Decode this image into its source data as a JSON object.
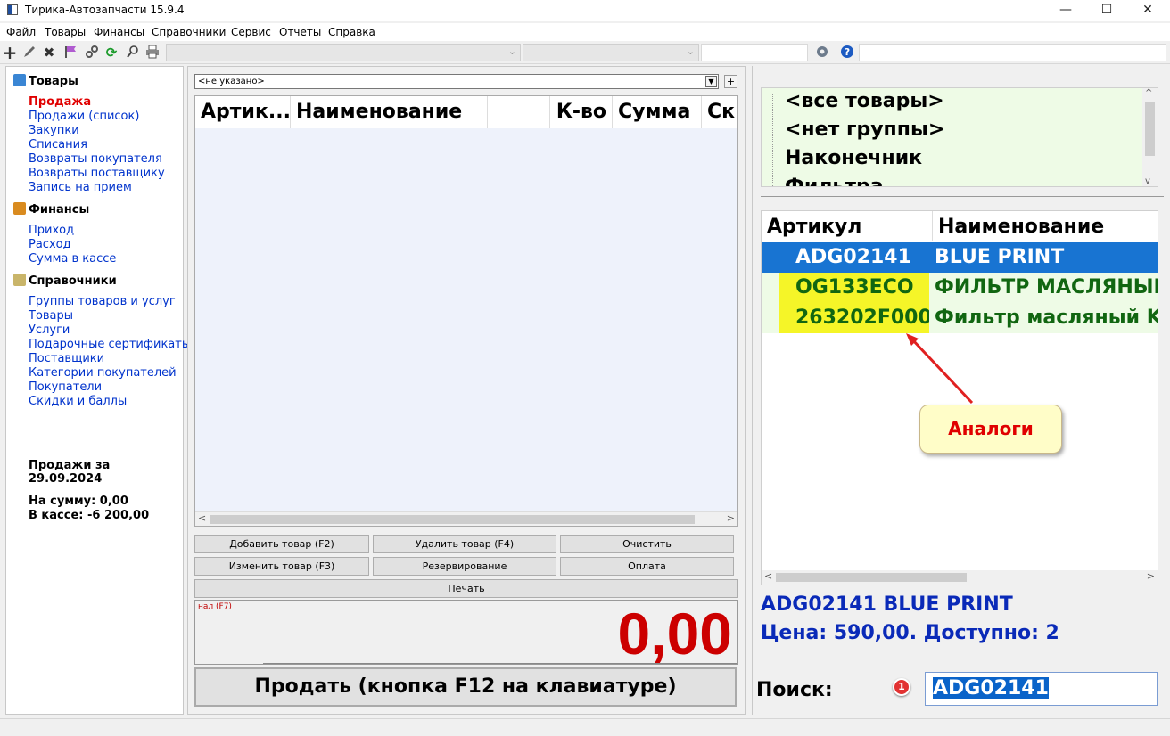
{
  "window": {
    "title": "Тирика-Автозапчасти 15.9.4",
    "min": "—",
    "max": "☐",
    "close": "✕"
  },
  "menu": [
    "Файл",
    "Товары",
    "Финансы",
    "Справочники",
    "Сервис",
    "Отчеты",
    "Справка"
  ],
  "toolbar": {
    "icons": [
      "add-icon",
      "edit-icon",
      "delete-icon",
      "flag-icon",
      "link-icon",
      "refresh-icon",
      "search-icon",
      "print-icon",
      "settings-icon",
      "help-icon"
    ],
    "combo_arrow": "⌄"
  },
  "nav": {
    "sections": [
      {
        "title": "Товары",
        "icon": "box-icon",
        "color": "#3a86d4",
        "items": [
          "Продажа",
          "Продажи (список)",
          "Закупки",
          "Списания",
          "Возвраты покупателя",
          "Возвраты поставщику",
          "Запись на прием"
        ]
      },
      {
        "title": "Финансы",
        "icon": "briefcase-icon",
        "color": "#d98b1f",
        "items": [
          "Приход",
          "Расход",
          "Сумма в кассе"
        ]
      },
      {
        "title": "Справочники",
        "icon": "books-icon",
        "color": "#c9b56a",
        "items": [
          "Группы товаров и услуг",
          "Товары",
          "Услуги",
          "Подарочные сертификать",
          "Поставщики",
          "Категории покупателей",
          "Покупатели",
          "Скидки и баллы"
        ]
      }
    ],
    "active": "Продажа",
    "stats": {
      "date_line": "Продажи за 29.09.2024",
      "sum_line": "На сумму: 0,00",
      "cash_line": "В кассе: -6 200,00"
    }
  },
  "sale": {
    "customer": "<не указано>",
    "customer_add": "+",
    "columns": [
      "Артик...",
      "Наименование",
      "",
      "К-во",
      "Сумма",
      "Ск"
    ],
    "buttons": {
      "add": "Добавить товар (F2)",
      "remove": "Удалить товар (F4)",
      "clear": "Очистить",
      "edit": "Изменить товар (F3)",
      "reserve": "Резервирование",
      "pay": "Оплата",
      "print": "Печать"
    },
    "pay_label": "нал (F7)",
    "total": "0,00",
    "sell": "Продать (кнопка F12 на клавиатуре)"
  },
  "groups": [
    "<все товары>",
    "<нет группы>",
    "Наконечник",
    "Фильтра"
  ],
  "results": {
    "columns": [
      "Артикул",
      "Наименование"
    ],
    "rows": [
      {
        "article": "ADG02141",
        "name": "BLUE PRINT",
        "kind": "selected"
      },
      {
        "article": "OG133ECO",
        "name": "ФИЛЬТР МАСЛЯНЫЙ",
        "kind": "analog"
      },
      {
        "article": "263202F000",
        "name": "Фильтр масляный K",
        "kind": "analog"
      }
    ]
  },
  "callout": "Аналоги",
  "selected_info": {
    "line1": "ADG02141 BLUE PRINT",
    "line2": "Цена: 590,00. Доступно: 2"
  },
  "search": {
    "label": "Поиск:",
    "badge": "1",
    "value": "ADG02141"
  },
  "colors": {
    "accent": "#1874d2",
    "analog_bg": "#eefbe6",
    "analog_article": "#f5f528",
    "total": "#cc0000",
    "info": "#0a2ab8"
  }
}
